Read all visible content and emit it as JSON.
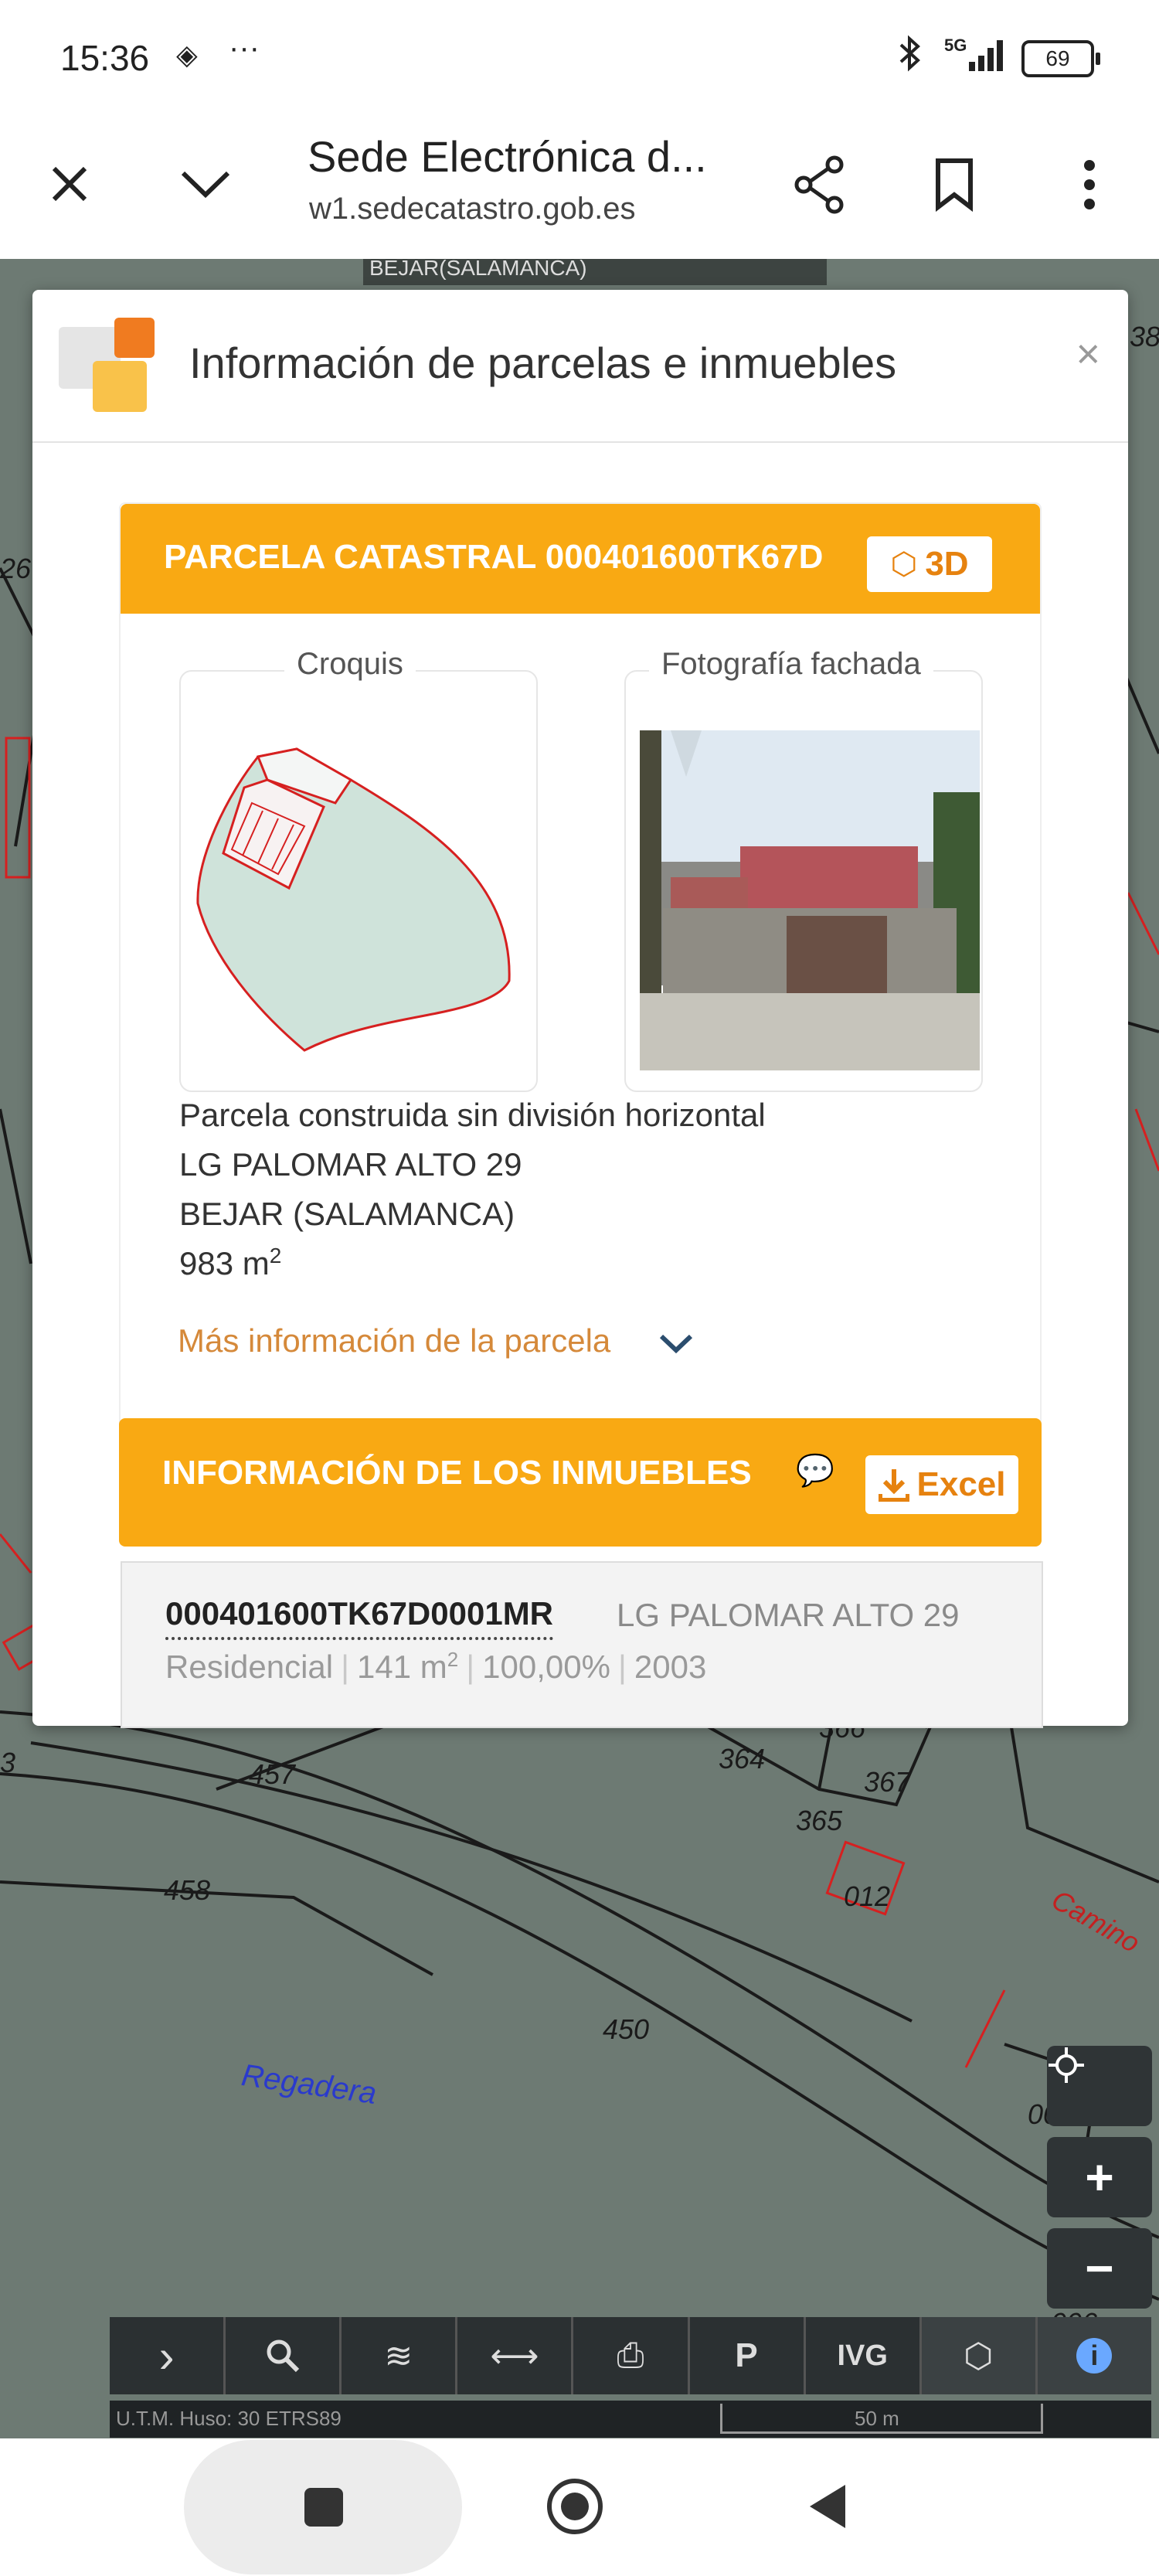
{
  "status_bar": {
    "time": "15:36",
    "network": "5G",
    "battery": "69"
  },
  "browser": {
    "page_title": "Sede Electrónica d...",
    "url": "w1.sedecatastro.gob.es",
    "icons": [
      "close-icon",
      "chevron-down-icon",
      "share-icon",
      "bookmark-icon",
      "more-vert-icon"
    ]
  },
  "map": {
    "top_label": "BEJAR(SALAMANCA)",
    "parcel_labels": [
      "457",
      "458",
      "450",
      "364",
      "365",
      "366",
      "367",
      "012",
      "002",
      "006",
      "38",
      "26",
      "3"
    ],
    "road_labels": [
      "Regadera",
      "Camino"
    ],
    "scale": "50 m",
    "projection": "U.T.M. Huso: 30 ETRS89",
    "zoom_in": "+",
    "zoom_out": "−",
    "toolbar": [
      {
        "name": "expand",
        "icon": "chevron-right-icon",
        "glyph": "›"
      },
      {
        "name": "search",
        "icon": "search-icon",
        "glyph": "⌕"
      },
      {
        "name": "layers",
        "icon": "layers-icon",
        "glyph": "≋"
      },
      {
        "name": "measure",
        "icon": "measure-icon",
        "glyph": "⟷"
      },
      {
        "name": "print",
        "icon": "print-icon",
        "glyph": "⎙"
      },
      {
        "name": "coords",
        "icon": "coordinates-icon",
        "glyph": "P"
      },
      {
        "name": "ivg",
        "icon": "ivg-icon",
        "glyph": "IVG"
      },
      {
        "name": "3d",
        "icon": "cubes-icon",
        "glyph": "⬡"
      },
      {
        "name": "info",
        "icon": "info-icon",
        "glyph": "i"
      }
    ]
  },
  "dialog": {
    "title": "Información de parcelas e inmuebles",
    "close": "×",
    "parcel": {
      "header": "PARCELA CATASTRAL 000401600TK67D",
      "button_3d": "3D",
      "sketch_title": "Croquis",
      "photo_title": "Fotografía fachada",
      "type": "Parcela construida sin división horizontal",
      "address": "LG PALOMAR ALTO 29",
      "city": "BEJAR (SALAMANCA)",
      "area_value": "983 m",
      "area_exp": "2",
      "more_info": "Más información de la parcela"
    },
    "properties": {
      "header": "INFORMACIÓN DE LOS INMUEBLES",
      "excel_button": "Excel",
      "items": [
        {
          "ref": "000401600TK67D0001MR",
          "address": "LG PALOMAR ALTO 29",
          "use": "Residencial",
          "area": "141 m",
          "area_exp": "2",
          "share": "100,00%",
          "year": "2003"
        }
      ]
    }
  },
  "colors": {
    "accent": "#f9a913",
    "map_bg": "#6d7a73",
    "parcel_fill": "#cfe3da",
    "parcel_line": "#d62020"
  }
}
